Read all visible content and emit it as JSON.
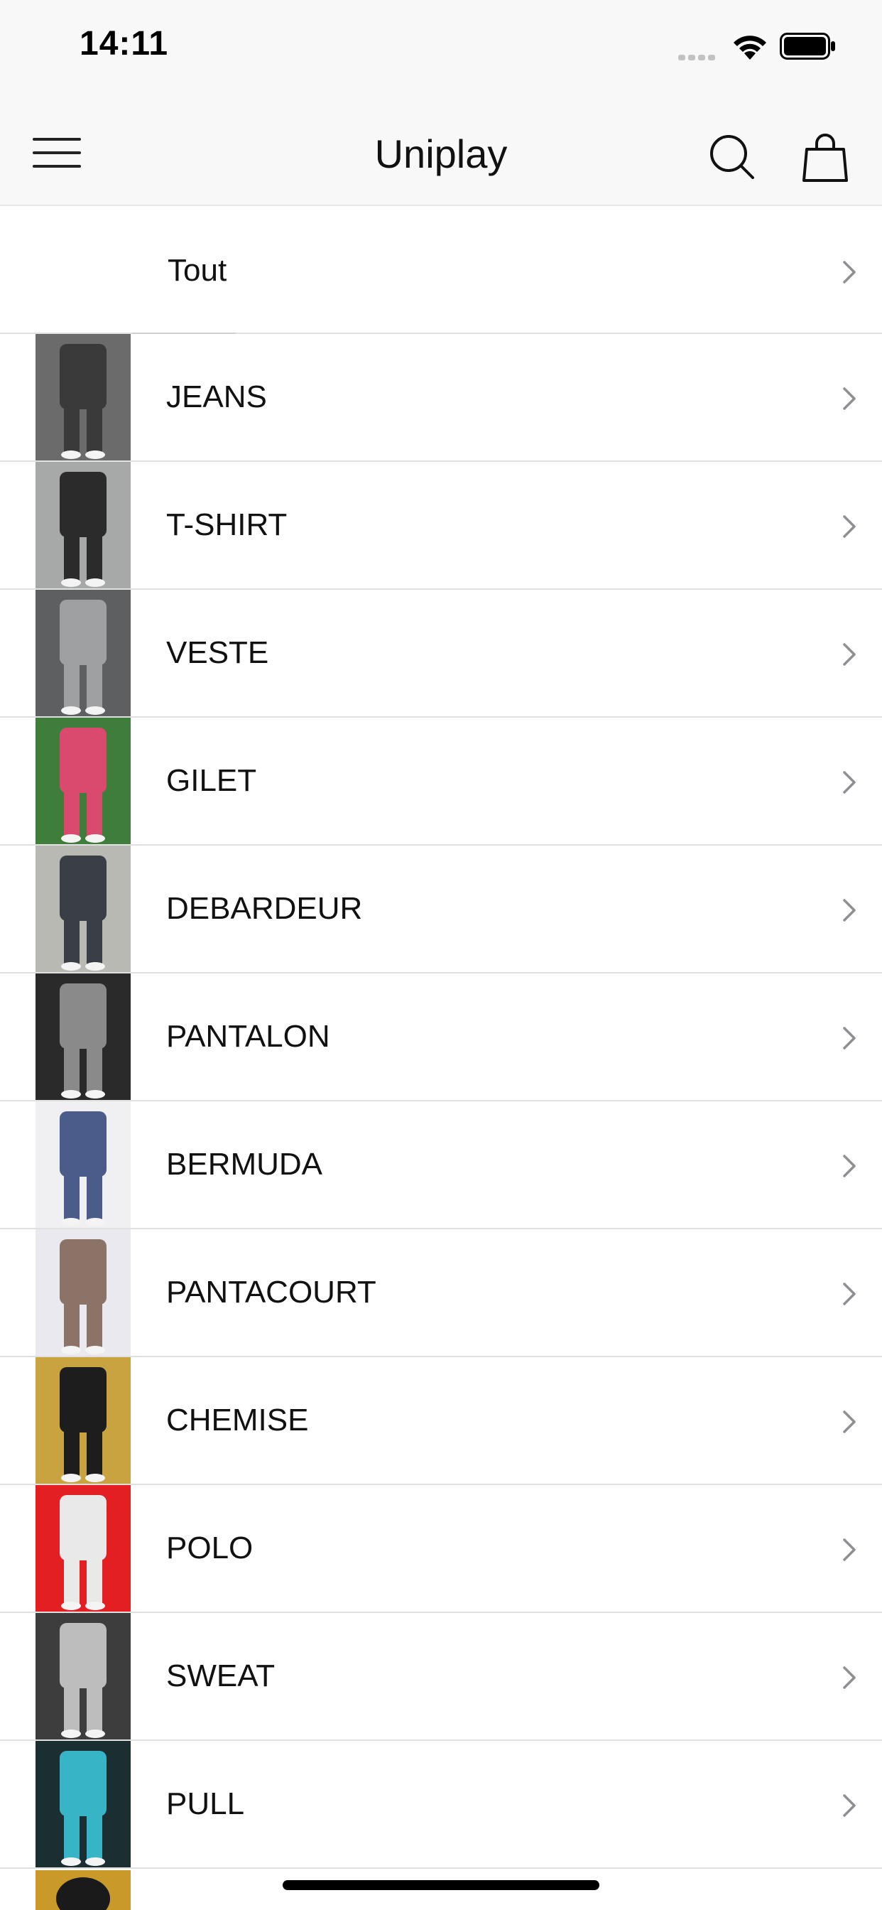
{
  "status_bar": {
    "time": "14:11"
  },
  "nav": {
    "title": "Uniplay",
    "menu_icon": "hamburger-menu-icon",
    "search_icon": "search-icon",
    "bag_icon": "shopping-bag-icon"
  },
  "categories": [
    {
      "label": "Tout",
      "thumb_colors": [
        "#ffffff",
        "#ffffff"
      ]
    },
    {
      "label": "JEANS",
      "thumb_colors": [
        "#6b6b6b",
        "#3a3a3a"
      ]
    },
    {
      "label": "T-SHIRT",
      "thumb_colors": [
        "#a7a9a8",
        "#2b2b2b"
      ]
    },
    {
      "label": "VESTE",
      "thumb_colors": [
        "#5e5f61",
        "#9fa0a2"
      ]
    },
    {
      "label": "GILET",
      "thumb_colors": [
        "#3f7d3a",
        "#d94a6e"
      ]
    },
    {
      "label": "DEBARDEUR",
      "thumb_colors": [
        "#b9b9b3",
        "#3a3f45"
      ]
    },
    {
      "label": "PANTALON",
      "thumb_colors": [
        "#2a2a2a",
        "#8a8a8a"
      ]
    },
    {
      "label": "BERMUDA",
      "thumb_colors": [
        "#f0f0f3",
        "#4b5c8a"
      ]
    },
    {
      "label": "PANTACOURT",
      "thumb_colors": [
        "#e9e9ef",
        "#8c7368"
      ]
    },
    {
      "label": "CHEMISE",
      "thumb_colors": [
        "#c9a340",
        "#1d1d1d"
      ]
    },
    {
      "label": "POLO",
      "thumb_colors": [
        "#e41f22",
        "#e9e9ea"
      ]
    },
    {
      "label": "SWEAT",
      "thumb_colors": [
        "#3d3d3d",
        "#bdbdbd"
      ]
    },
    {
      "label": "PULL",
      "thumb_colors": [
        "#1b2f33",
        "#37b4c6"
      ]
    }
  ],
  "colors": {
    "bar_background": "#f8f8f8",
    "separator": "#e0e0e0",
    "chevron": "#8e8e93"
  }
}
